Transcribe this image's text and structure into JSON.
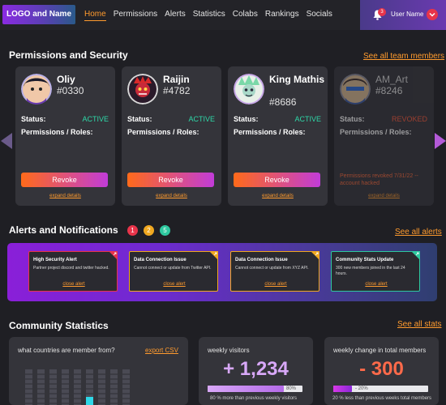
{
  "nav": {
    "logo": "LOGO and Name",
    "links": [
      "Home",
      "Permissions",
      "Alerts",
      "Statistics",
      "Colabs",
      "Rankings",
      "Socials"
    ],
    "notification_count": "3",
    "user_name": "User Name"
  },
  "permissions": {
    "title": "Permissions and Security",
    "see_all": "See all team members",
    "status_label": "Status:",
    "roles_label": "Permissions / Roles:",
    "revoke_label": "Revoke",
    "expand_label": "expand details",
    "members": [
      {
        "name": "Oliy",
        "id": "#0330",
        "status": "ACTIVE"
      },
      {
        "name": "Raijin",
        "id": "#4782",
        "status": "ACTIVE"
      },
      {
        "name": "King Mathis",
        "id": "#8686",
        "status": "ACTIVE"
      },
      {
        "name": "AM_Art",
        "id": "#8246",
        "status": "REVOKED",
        "note": "Permissions revoked 7/31/22 -- account hacked"
      }
    ]
  },
  "alerts": {
    "title": "Alerts and Notifications",
    "see_all": "See all alerts",
    "counts": [
      "1",
      "2",
      "5"
    ],
    "close_label": "close alert",
    "items": [
      {
        "title": "High Security Alert",
        "text": "Partner project discord and twitter hacked."
      },
      {
        "title": "Data Connection Issue",
        "text": "Cannot connect or update from Twitter API."
      },
      {
        "title": "Data Connection Issue",
        "text": "Cannot connect or update from XYZ API."
      },
      {
        "title": "Community Stats Update",
        "text": "300 new members joined in the last 24 hours."
      }
    ]
  },
  "stats": {
    "title": "Community Statistics",
    "see_all": "See all stats",
    "countries": {
      "title": "what countries are member from?",
      "export": "export CSV"
    },
    "visitors": {
      "title": "weekly visitors",
      "value": "+ 1,234",
      "bar_pct": "80%",
      "bar_fraction": 0.8,
      "note": "80 % more than previous weekly visitors"
    },
    "members_change": {
      "title": "weekly change in total members",
      "value": "- 300",
      "bar_pct": "- 20%",
      "bar_fraction": 0.2,
      "note": "20 % less than previous weeks total members"
    }
  },
  "colors": {
    "accent": "#ff9b2e",
    "active": "#2ed8a8",
    "revoked": "#ff5a3a",
    "danger": "#e8344a"
  }
}
